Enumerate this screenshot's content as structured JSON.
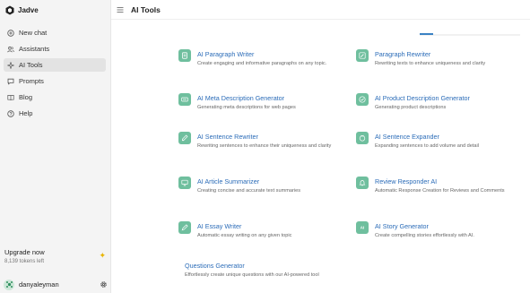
{
  "sidebar": {
    "brand": "Jadve",
    "items": [
      {
        "label": "New chat",
        "icon": "plus-circle-icon"
      },
      {
        "label": "Assistants",
        "icon": "users-icon"
      },
      {
        "label": "AI Tools",
        "icon": "sparkle-icon",
        "active": true
      },
      {
        "label": "Prompts",
        "icon": "message-icon"
      },
      {
        "label": "Blog",
        "icon": "book-icon"
      },
      {
        "label": "Help",
        "icon": "help-circle-icon"
      }
    ],
    "upgrade": {
      "title": "Upgrade now",
      "tokens": "8,139 tokens left"
    },
    "user": {
      "name": "danyaleyman"
    }
  },
  "header": {
    "title": "AI Tools"
  },
  "tools": [
    {
      "title": "AI Paragraph Writer",
      "desc": "Create engaging and informative paragraphs on any topic."
    },
    {
      "title": "Paragraph Rewriter",
      "desc": "Rewriting texts to enhance uniqueness and clarity"
    },
    {
      "title": "AI Meta Description Generator",
      "desc": "Generating meta descriptions for web pages"
    },
    {
      "title": "AI Product Description Generator",
      "desc": "Generating product descriptions"
    },
    {
      "title": "AI Sentence Rewriter",
      "desc": "Rewriting sentences to enhance their uniqueness and clarity"
    },
    {
      "title": "AI Sentence Expander",
      "desc": "Expanding sentences to add volume and detail"
    },
    {
      "title": "AI Article Summarizer",
      "desc": "Creating concise and accurate text summaries"
    },
    {
      "title": "Review Responder AI",
      "desc": "Automatic Response Creation for Reviews and Comments"
    },
    {
      "title": "AI Essay Writer",
      "desc": "Automatic essay writing on any given topic"
    },
    {
      "title": "AI Story Generator",
      "desc": "Create compelling stories effortlessly with AI."
    },
    {
      "title": "Questions Generator",
      "desc": "Effortlessly create unique questions with our AI-powered tool"
    }
  ],
  "colors": {
    "accent": "#2b6cb8",
    "icon_bg": "#6fbf9e",
    "active_bg": "#e3e3e3"
  }
}
